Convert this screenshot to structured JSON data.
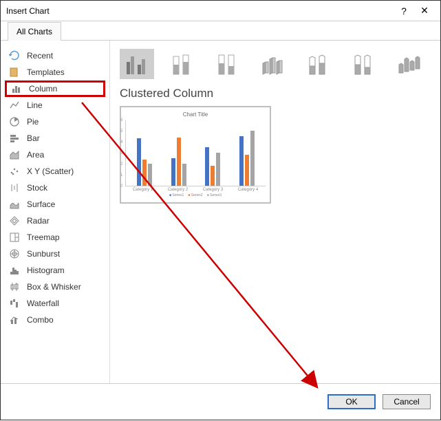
{
  "titlebar": {
    "title": "Insert Chart",
    "help": "?",
    "close": "✕"
  },
  "tabs": {
    "all_charts": "All Charts"
  },
  "sidebar": {
    "items": [
      {
        "icon": "recent-icon",
        "label": "Recent"
      },
      {
        "icon": "templates-icon",
        "label": "Templates"
      },
      {
        "icon": "column-icon",
        "label": "Column"
      },
      {
        "icon": "line-icon",
        "label": "Line"
      },
      {
        "icon": "pie-icon",
        "label": "Pie"
      },
      {
        "icon": "bar-icon",
        "label": "Bar"
      },
      {
        "icon": "area-icon",
        "label": "Area"
      },
      {
        "icon": "scatter-icon",
        "label": "X Y (Scatter)"
      },
      {
        "icon": "stock-icon",
        "label": "Stock"
      },
      {
        "icon": "surface-icon",
        "label": "Surface"
      },
      {
        "icon": "radar-icon",
        "label": "Radar"
      },
      {
        "icon": "treemap-icon",
        "label": "Treemap"
      },
      {
        "icon": "sunburst-icon",
        "label": "Sunburst"
      },
      {
        "icon": "histogram-icon",
        "label": "Histogram"
      },
      {
        "icon": "boxwhisker-icon",
        "label": "Box & Whisker"
      },
      {
        "icon": "waterfall-icon",
        "label": "Waterfall"
      },
      {
        "icon": "combo-icon",
        "label": "Combo"
      }
    ],
    "selected_index": 2
  },
  "main": {
    "heading": "Clustered Column",
    "preview_title": "Chart Title"
  },
  "footer": {
    "ok": "OK",
    "cancel": "Cancel"
  },
  "chart_data": {
    "type": "bar",
    "title": "Chart Title",
    "categories": [
      "Category 1",
      "Category 2",
      "Category 3",
      "Category 4"
    ],
    "series": [
      {
        "name": "Series1",
        "values": [
          4.3,
          2.5,
          3.5,
          4.5
        ]
      },
      {
        "name": "Series2",
        "values": [
          2.4,
          4.4,
          1.8,
          2.8
        ]
      },
      {
        "name": "Series3",
        "values": [
          2.0,
          2.0,
          3.0,
          5.0
        ]
      }
    ],
    "ylim": [
      0,
      6
    ],
    "yticks": [
      0,
      1,
      2,
      3,
      4,
      5,
      6
    ]
  },
  "colors": {
    "brand_blue": "#4472c4",
    "brand_orange": "#ed7d31",
    "brand_gray": "#a5a5a5",
    "accent_red": "#cc0000",
    "focus_blue": "#2a6dc9"
  }
}
